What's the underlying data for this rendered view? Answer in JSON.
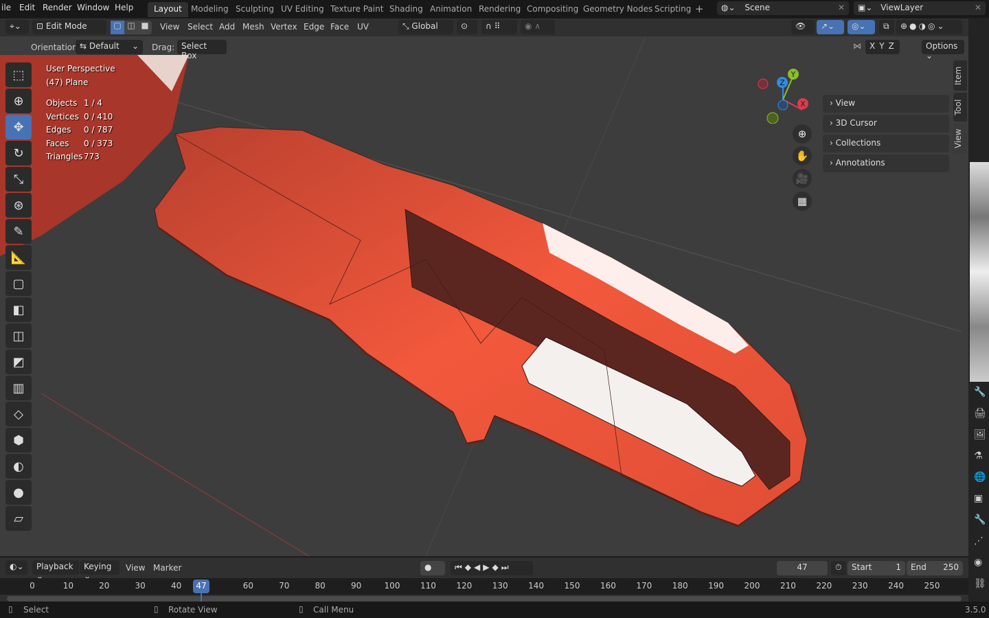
{
  "menu": [
    "ile",
    "Edit",
    "Render",
    "Window",
    "Help"
  ],
  "workspaces": [
    "Layout",
    "Modeling",
    "Sculpting",
    "UV Editing",
    "Texture Paint",
    "Shading",
    "Animation",
    "Rendering",
    "Compositing",
    "Geometry Nodes",
    "Scripting"
  ],
  "scene": "Scene",
  "view_layer": "ViewLayer",
  "header": {
    "mode": "Edit Mode",
    "menus": [
      "View",
      "Select",
      "Add",
      "Mesh",
      "Vertex",
      "Edge",
      "Face",
      "UV"
    ],
    "transform_orientation": "Global"
  },
  "tool_settings": {
    "orientation_label": "Orientation:",
    "orientation": "Default",
    "drag_label": "Drag:",
    "drag": "Select Box",
    "axes": [
      "X",
      "Y",
      "Z"
    ],
    "options": "Options"
  },
  "overlay": {
    "view": "User Perspective",
    "object": "(47) Plane",
    "stats": [
      {
        "k": "Objects",
        "v": "1 / 4"
      },
      {
        "k": "Vertices",
        "v": "0 / 410"
      },
      {
        "k": "Edges",
        "v": "0 / 787"
      },
      {
        "k": "Faces",
        "v": "0 / 373"
      },
      {
        "k": "Triangles",
        "v": "773"
      }
    ]
  },
  "gizmo": {
    "x": "X",
    "y": "Y",
    "z": "Z"
  },
  "npanel": {
    "items": [
      "View",
      "3D Cursor",
      "Collections",
      "Annotations"
    ],
    "tabs": [
      "Item",
      "Tool",
      "View"
    ]
  },
  "timeline": {
    "menus": [
      "Playback",
      "Keying",
      "View",
      "Marker"
    ],
    "current_frame": "47",
    "start_label": "Start",
    "start": "1",
    "end_label": "End",
    "end": "250",
    "ticks": [
      "0",
      "10",
      "20",
      "30",
      "40",
      "50",
      "60",
      "70",
      "80",
      "90",
      "100",
      "110",
      "120",
      "130",
      "140",
      "150",
      "160",
      "170",
      "180",
      "190",
      "200",
      "210",
      "220",
      "230",
      "240",
      "250"
    ]
  },
  "status": {
    "select": "Select",
    "rotate": "Rotate View",
    "menu": "Call Menu",
    "version": "3.5.0"
  },
  "colors": {
    "accent": "#4772b3",
    "mesh": "#e0533a",
    "x_axis": "#e03a4f",
    "y_axis": "#8bbe2a",
    "z_axis": "#2e8de8"
  }
}
